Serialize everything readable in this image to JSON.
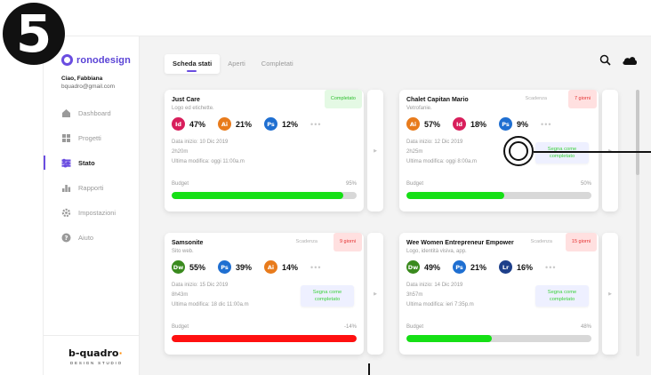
{
  "step_badge": "5",
  "brand": {
    "colors": {
      "accent": "#6a4de0",
      "green": "#15e015",
      "red": "#ff1010",
      "logo_orange": "#ff8a00"
    }
  },
  "sidebar": {
    "logo_text": "ronodesign",
    "user_name": "Ciao, Fabbiana",
    "user_email": "bquadro@gmail.com",
    "items": [
      {
        "label": "Dashboard",
        "icon": "home-icon"
      },
      {
        "label": "Progetti",
        "icon": "grid-icon"
      },
      {
        "label": "Stato",
        "icon": "sliders-icon",
        "active": true
      },
      {
        "label": "Rapporti",
        "icon": "bar-chart-icon"
      },
      {
        "label": "Impostazioni",
        "icon": "gear-icon"
      },
      {
        "label": "Aiuto",
        "icon": "help-icon"
      }
    ],
    "footer_logo": "b-quadro",
    "footer_logo_suffix": "·",
    "footer_sub": "DESIGN STUDIO"
  },
  "tabs": [
    {
      "label": "Scheda stati",
      "active": true
    },
    {
      "label": "Aperti"
    },
    {
      "label": "Completati"
    }
  ],
  "header_icons": [
    "search-icon",
    "cloud-icon"
  ],
  "cards": [
    {
      "title": "Just Care",
      "subtitle": "Logo ed etichette.",
      "status": "Completato",
      "apps": [
        {
          "abbr": "Id",
          "pct": "47%",
          "color": "#d81e5b"
        },
        {
          "abbr": "Ai",
          "pct": "21%",
          "color": "#e87b1c"
        },
        {
          "abbr": "Ps",
          "pct": "12%",
          "color": "#1f6fd1"
        }
      ],
      "more": "•••",
      "start": "Data inizio: 10 Dic 2019",
      "duration": "2h20m",
      "last_modified": "Ultima modifica: oggi 11:00a.m",
      "budget_label": "Budget",
      "budget_pct": "95%",
      "budget_fill": 0.93,
      "bar_color": "#15e015"
    },
    {
      "title": "Chalet Capitan Mario",
      "subtitle": "Vetrofanie.",
      "due_label": "Scadenza",
      "due": "7 giorni",
      "apps": [
        {
          "abbr": "Ai",
          "pct": "57%",
          "color": "#e87b1c"
        },
        {
          "abbr": "Id",
          "pct": "18%",
          "color": "#d81e5b"
        },
        {
          "abbr": "Ps",
          "pct": "9%",
          "color": "#1f6fd1"
        }
      ],
      "more": "•••",
      "start": "Data inizio: 12 Dic 2019",
      "duration": "2h25m",
      "last_modified": "Ultima modifica: oggi 8:00a.m",
      "mark_done": "Segna come completato",
      "budget_label": "Budget",
      "budget_pct": "50%",
      "budget_fill": 0.53,
      "bar_color": "#15e015"
    },
    {
      "title": "Samsonite",
      "subtitle": "Sito web.",
      "due_label": "Scadenza",
      "due": "9 giorni",
      "apps": [
        {
          "abbr": "Dw",
          "pct": "55%",
          "color": "#3a8a1e"
        },
        {
          "abbr": "Ps",
          "pct": "39%",
          "color": "#1f6fd1"
        },
        {
          "abbr": "Ai",
          "pct": "14%",
          "color": "#e87b1c"
        }
      ],
      "more": "•••",
      "start": "Data inizio: 15 Dic 2019",
      "duration": "8h43m",
      "last_modified": "Ultima modifica: 18 dic 11:00a.m",
      "mark_done": "Segna come completato",
      "budget_label": "Budget",
      "budget_pct": "-14%",
      "budget_fill": 1.0,
      "bar_color": "#ff1010"
    },
    {
      "title": "Wee Women Entrepreneur Empower",
      "subtitle": "Logo, identità visiva, app.",
      "due_label": "Scadenza",
      "due": "15 giorni",
      "apps": [
        {
          "abbr": "Dw",
          "pct": "49%",
          "color": "#3a8a1e"
        },
        {
          "abbr": "Ps",
          "pct": "21%",
          "color": "#1f6fd1"
        },
        {
          "abbr": "Lr",
          "pct": "16%",
          "color": "#1d3f8a"
        }
      ],
      "more": "•••",
      "start": "Data inizio: 14 Dic 2019",
      "duration": "3h57m",
      "last_modified": "Ultima modifica: ieri 7:35p.m",
      "mark_done": "Segna come completato",
      "budget_label": "Budget",
      "budget_pct": "48%",
      "budget_fill": 0.46,
      "bar_color": "#15e015"
    }
  ]
}
